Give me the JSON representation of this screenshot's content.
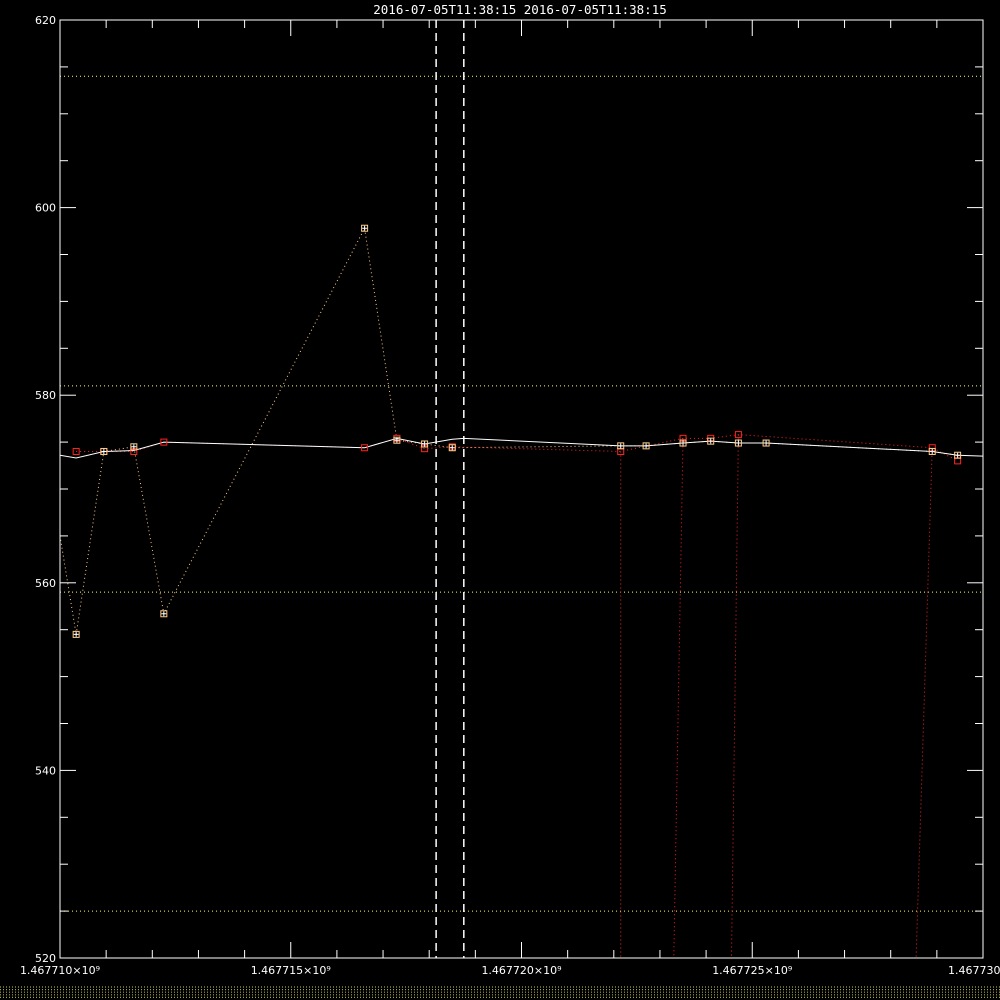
{
  "chart_data": {
    "type": "line",
    "title": "2016-07-05T11:38:15  2016-07-05T11:38:15",
    "xlim": [
      1467710000,
      1467730000
    ],
    "ylim": [
      520,
      620
    ],
    "x_ticks": [
      1467710000,
      1467715000,
      1467720000,
      1467725000,
      1467730000
    ],
    "x_tick_labels": [
      "1.467710×10⁹",
      "1.467715×10⁹",
      "1.467720×10⁹",
      "1.467725×10⁹",
      "1.467730×10⁹"
    ],
    "y_ticks": [
      520,
      540,
      560,
      580,
      600,
      620
    ],
    "y_tick_labels": [
      "520",
      "540",
      "560",
      "580",
      "600",
      "620"
    ],
    "reference_lines": [
      614,
      581,
      559,
      525
    ],
    "vertical_markers": [
      1467718150,
      1467718750
    ],
    "colors": {
      "background": "#000000",
      "axes": "#ffffff",
      "model": "#ffffff",
      "observed": "#ff2222",
      "flagged": "#ffcc88",
      "reference": "#ffff66",
      "bottom_strip": "#b6b84a"
    },
    "series": [
      {
        "style": "solid",
        "x": [
          1467710000,
          1467710350,
          1467710950,
          1467711600,
          1467712250,
          1467716600,
          1467717300,
          1467717900,
          1467718500,
          1467718750,
          1467722150,
          1467722700,
          1467723500,
          1467724100,
          1467724700,
          1467725300,
          1467728900,
          1467729450,
          1467730000
        ],
        "y": [
          573.6,
          573.3,
          574.0,
          574.1,
          575.0,
          574.4,
          575.4,
          574.8,
          575.3,
          575.4,
          574.6,
          574.6,
          574.9,
          575.1,
          574.9,
          574.9,
          574.0,
          573.6,
          573.5
        ]
      },
      {
        "style": "dotted-markers",
        "x": [
          1467710350,
          1467710950,
          1467711600,
          1467712250,
          1467716600,
          1467717300,
          1467717900,
          1467718500,
          1467722150,
          1467723500,
          1467724100,
          1467724700,
          1467728900,
          1467729450
        ],
        "y": [
          574.0,
          574.0,
          574.0,
          575.0,
          574.4,
          575.4,
          574.3,
          574.5,
          574.0,
          575.4,
          575.4,
          575.8,
          574.4,
          573.0
        ]
      },
      {
        "style": "dotted-markers",
        "x": [
          1467710000,
          1467710350,
          1467710950,
          1467711600,
          1467712250,
          1467716600,
          1467717300,
          1467717900,
          1467718500,
          1467722150,
          1467722700,
          1467723500,
          1467724100,
          1467724700,
          1467725300,
          1467728900,
          1467729450
        ],
        "y": [
          565,
          554.5,
          574.0,
          574.5,
          556.7,
          597.8,
          575.2,
          574.8,
          574.4,
          574.6,
          574.6,
          574.9,
          575.1,
          574.9,
          574.9,
          574.0,
          573.6
        ]
      }
    ],
    "dropouts": [
      {
        "x": [
          1467722150,
          1467722150
        ],
        "y": [
          574.0,
          520
        ]
      },
      {
        "x": [
          1467723500,
          1467723300
        ],
        "y": [
          575.4,
          520
        ]
      },
      {
        "x": [
          1467724700,
          1467724550
        ],
        "y": [
          575.8,
          520
        ]
      },
      {
        "x": [
          1467728900,
          1467728550
        ],
        "y": [
          574.4,
          520
        ]
      }
    ]
  }
}
